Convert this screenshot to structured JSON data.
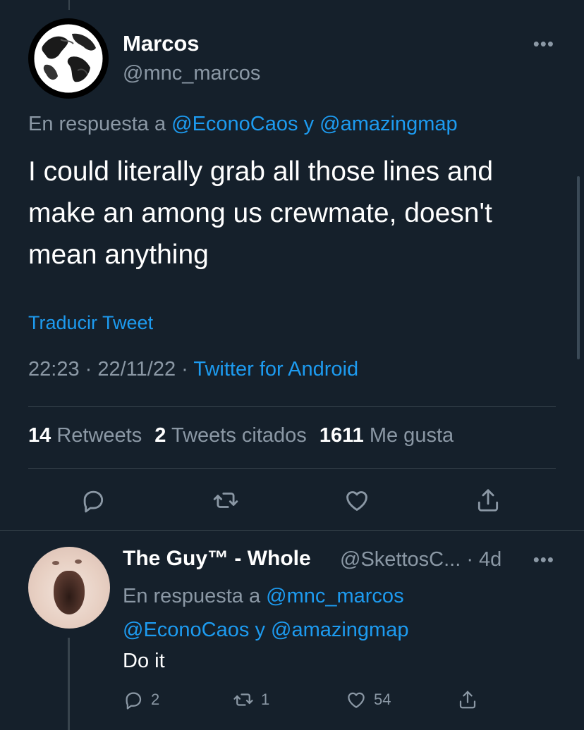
{
  "tweet": {
    "author_name": "Marcos",
    "author_handle": "@mnc_marcos",
    "reply_prefix": "En respuesta a",
    "reply_user1": "@EconoCaos",
    "reply_joiner": "y",
    "reply_user2": "@amazingmap",
    "text": "I could literally grab all those lines and make an among us crewmate, doesn't mean anything",
    "translate": "Traducir Tweet",
    "time": "22:23",
    "date": "22/11/22",
    "source": "Twitter for Android",
    "stats": {
      "retweets_count": "14",
      "retweets_label": "Retweets",
      "quotes_count": "2",
      "quotes_label": "Tweets citados",
      "likes_count": "1611",
      "likes_label": "Me gusta"
    }
  },
  "reply": {
    "author_name": "The Guy™ - Whole",
    "author_handle": "@SkettosC...",
    "time_ago": "· 4d",
    "reply_prefix": "En respuesta a",
    "reply_user1": "@mnc_marcos",
    "reply_user2": "@EconoCaos",
    "reply_joiner": "y",
    "reply_user3": "@amazingmap",
    "text": "Do it",
    "replies": "2",
    "retweets": "1",
    "likes": "54"
  },
  "icons": {
    "reply": "reply-icon",
    "retweet": "retweet-icon",
    "like": "heart-icon",
    "share": "share-icon",
    "more": "more-icon"
  },
  "colors": {
    "background": "#15202b",
    "accent": "#1d9bf0",
    "muted": "#8b98a5",
    "divider": "#38444d"
  }
}
